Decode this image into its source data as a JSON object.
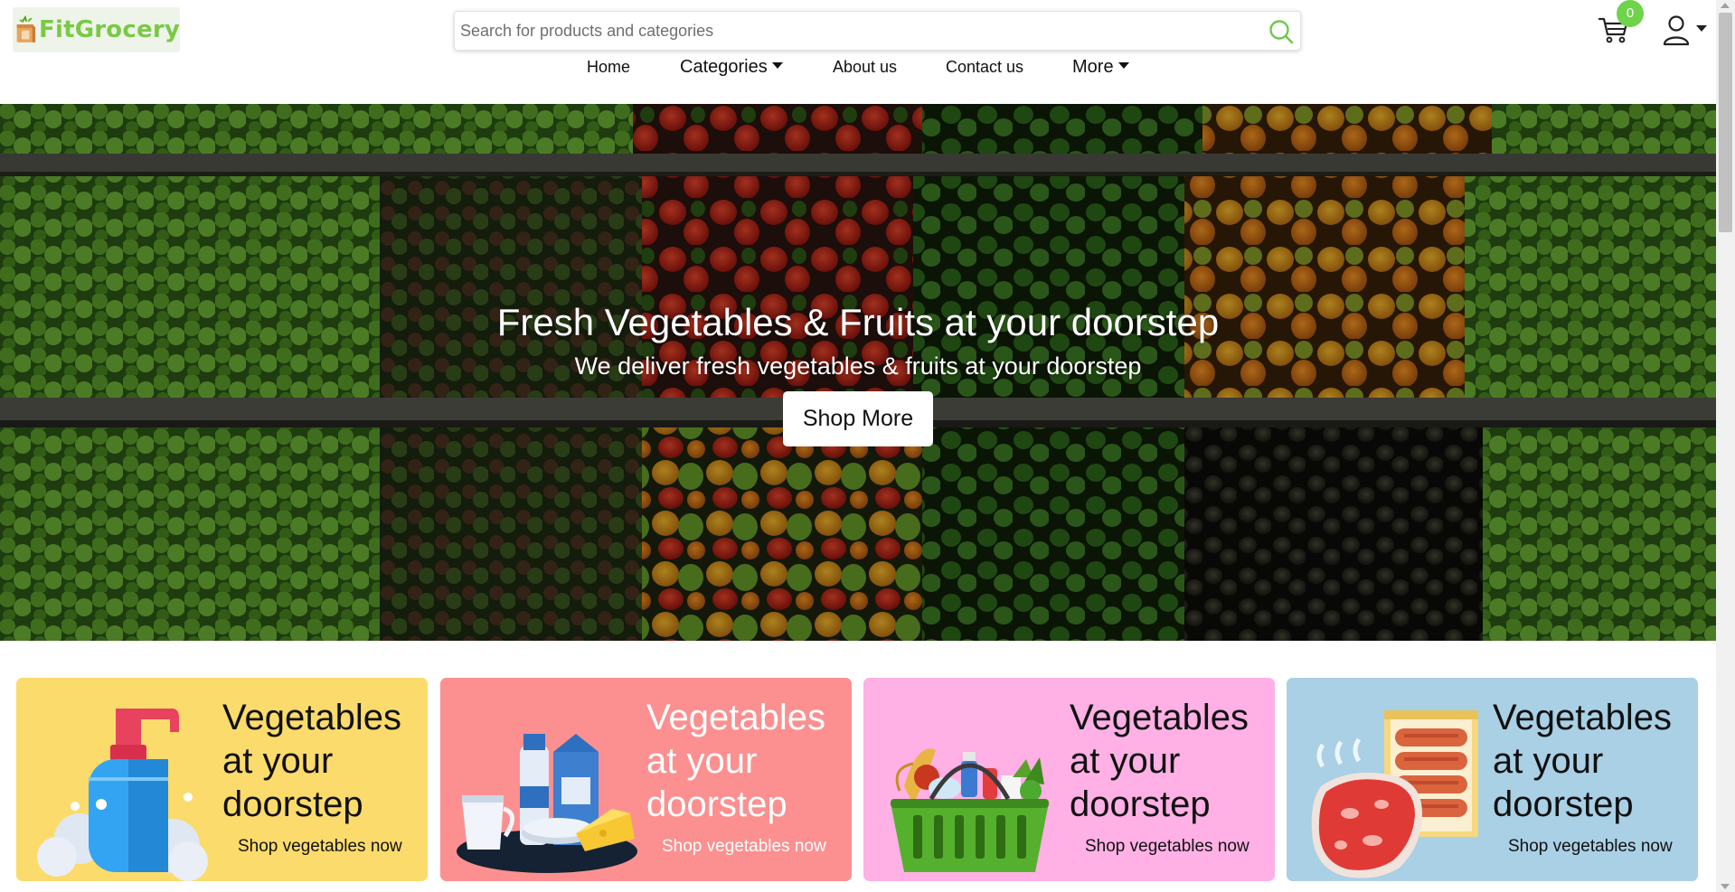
{
  "brand": {
    "name": "FitGrocery",
    "accent": "#7ac943"
  },
  "search": {
    "placeholder": "Search for products and categories",
    "icon": "search-icon"
  },
  "nav": {
    "home": "Home",
    "categories": "Categories",
    "about": "About us",
    "contact": "Contact us",
    "more": "More"
  },
  "cart": {
    "count": "0",
    "icon": "cart-icon",
    "badge_color": "#6fd34b"
  },
  "user": {
    "icon": "user-icon"
  },
  "hero": {
    "title": "Fresh Vegetables & Fruits at your doorstep",
    "subtitle": "We deliver fresh vegetables & fruits at your doorstep",
    "button": "Shop More"
  },
  "cards": [
    {
      "title": "Vegetables at your doorstep",
      "link": "Shop vegetables now",
      "bg": "#fbdb6c",
      "icon": "soap-dispenser-icon"
    },
    {
      "title": "Vegetables at your doorstep",
      "link": "Shop vegetables now",
      "bg": "#fc9090",
      "icon": "dairy-products-icon"
    },
    {
      "title": "Vegetables at your doorstep",
      "link": "Shop vegetables now",
      "bg": "#ffb0e5",
      "icon": "grocery-basket-icon"
    },
    {
      "title": "Vegetables at your doorstep",
      "link": "Shop vegetables now",
      "bg": "#a9d0e5",
      "icon": "meat-sausages-icon"
    }
  ]
}
